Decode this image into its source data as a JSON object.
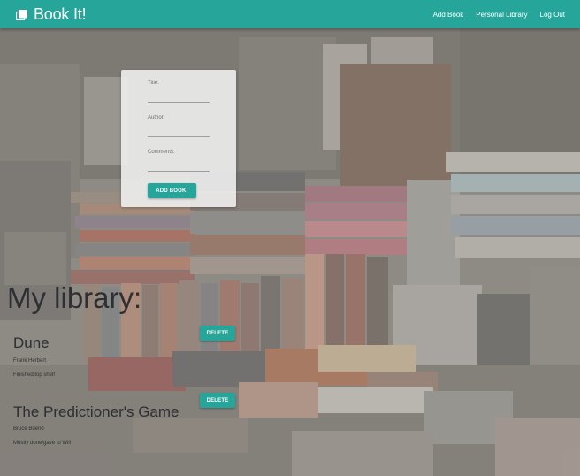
{
  "navbar": {
    "brand": "Book It!",
    "links": [
      "Add Book",
      "Personal Library",
      "Log Out"
    ]
  },
  "form": {
    "title_label": "Title:",
    "author_label": "Author:",
    "comments_label": "Comments:",
    "submit_label": "Add Book!"
  },
  "library": {
    "heading": "My library:",
    "delete_label": "Delete",
    "books": [
      {
        "title": "Dune",
        "author": "Frank Herbert",
        "comments": "Finished/top shelf"
      },
      {
        "title": "The Predictioner's Game",
        "author": "Bruce Bueno",
        "comments": "Mostly done/gave to Will"
      }
    ]
  },
  "colors": {
    "accent": "#26a69a",
    "text_dark": "#2d2f33"
  },
  "icons": {
    "brand": "book-stack-icon"
  }
}
